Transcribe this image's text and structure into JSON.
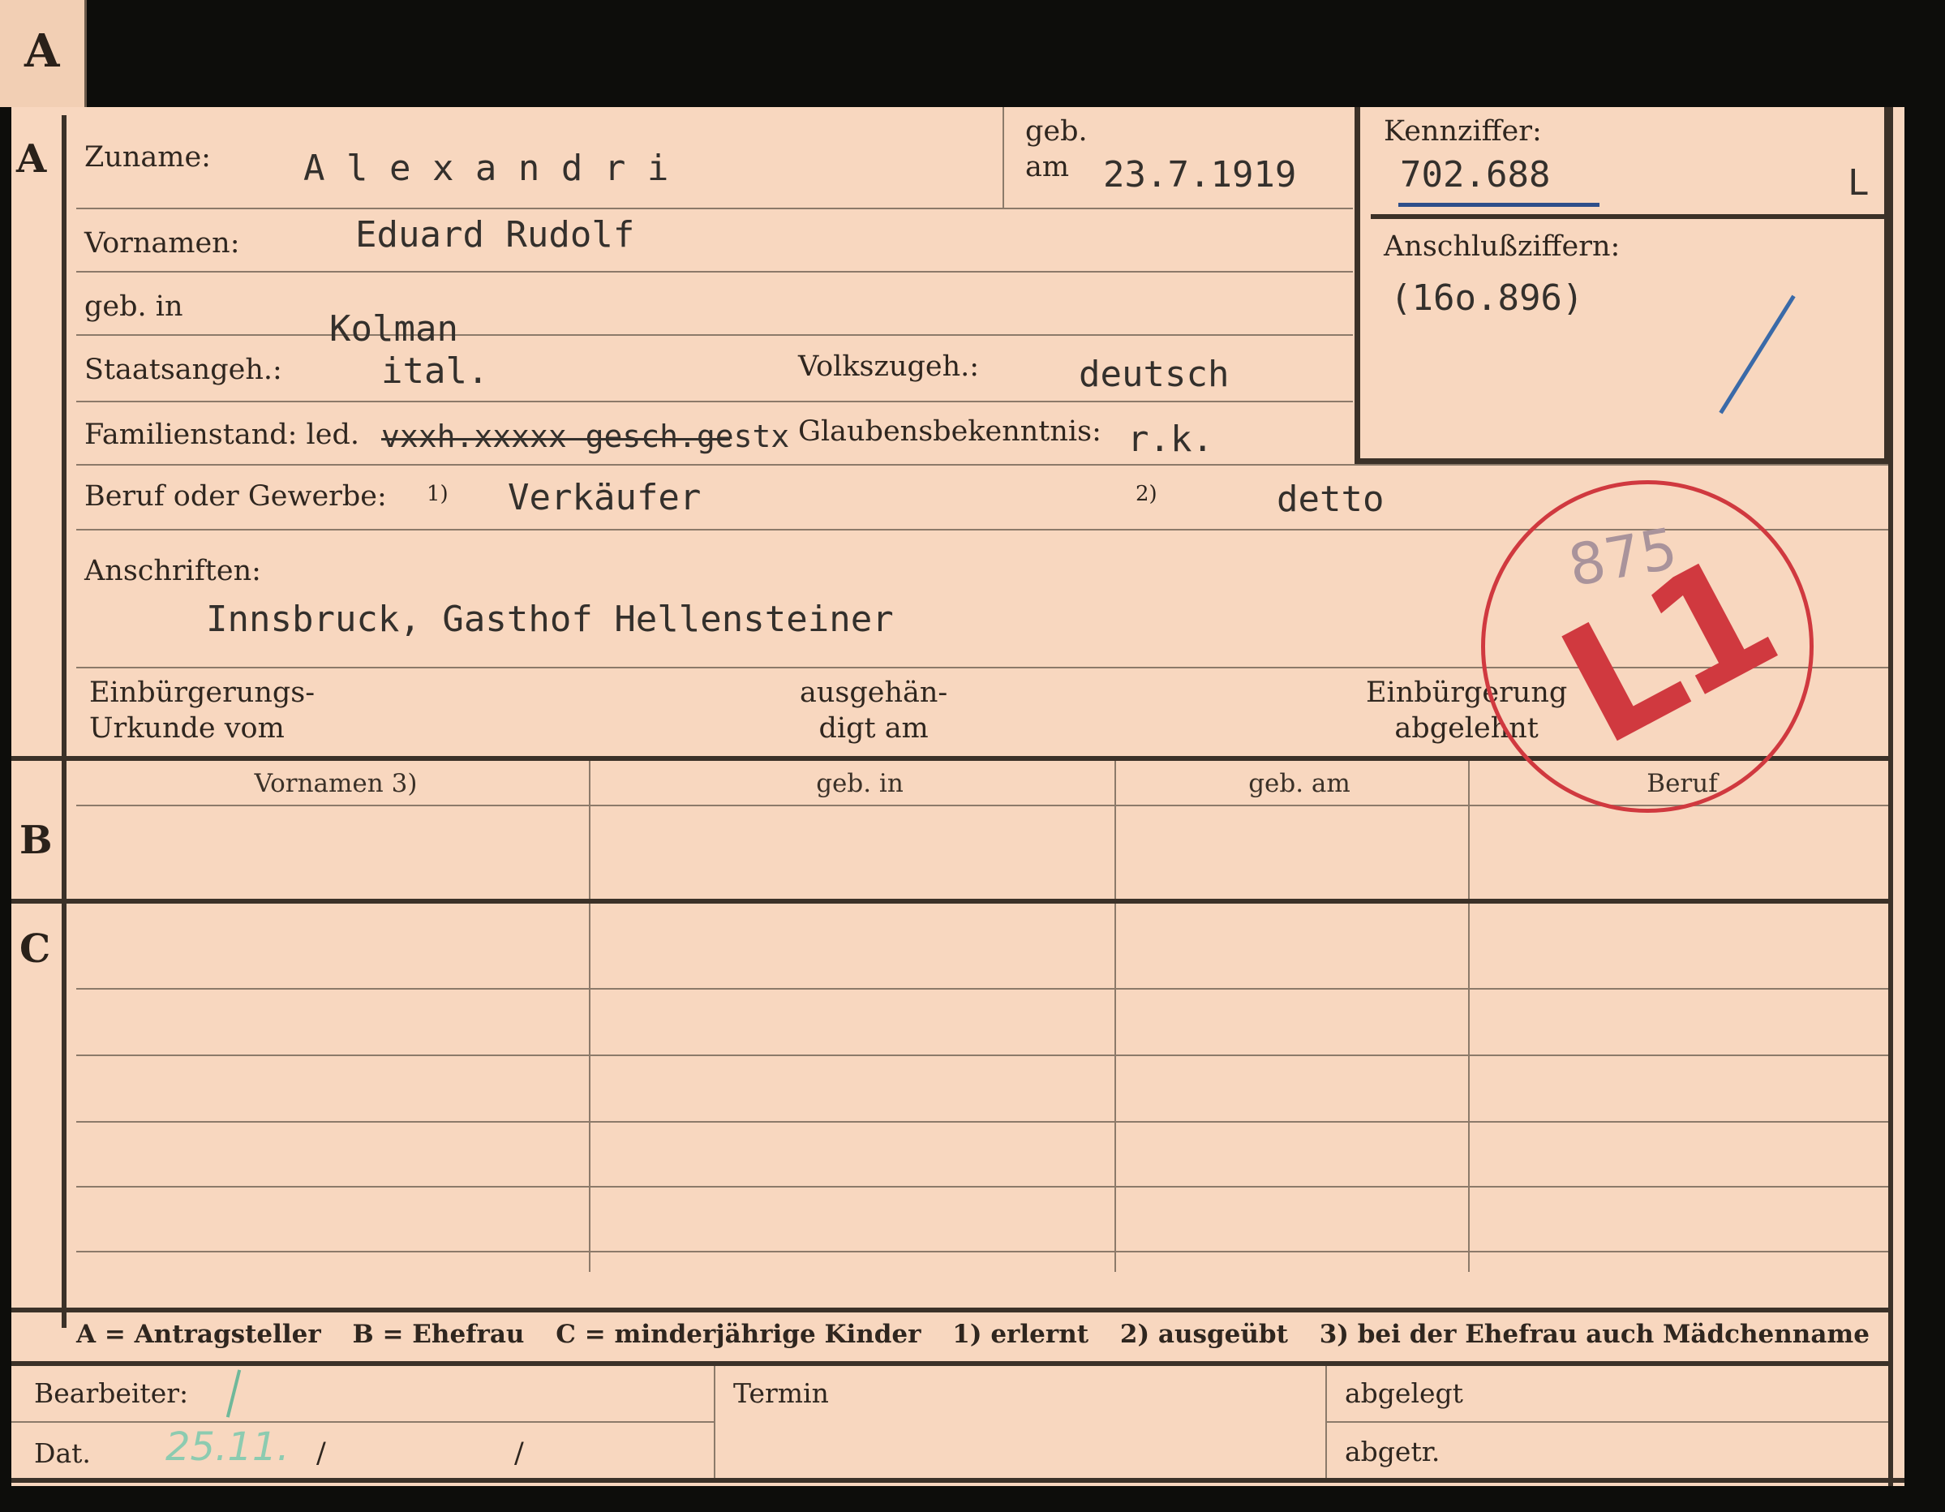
{
  "tab": {
    "letter": "A"
  },
  "section_letters": {
    "a": "A",
    "b": "B",
    "c": "C"
  },
  "fields": {
    "zuname_label": "Zuname:",
    "zuname_value": "A l e x a n d r i",
    "geb_label": "geb.",
    "am_label": "am",
    "birth_date": "23.7.1919",
    "kennziffer_label": "Kennziffer:",
    "kennziffer_value": "702.688",
    "kennziffer_suffix": "L",
    "vornamen_label": "Vornamen:",
    "vornamen_value": "Eduard Rudolf",
    "anschluss_label": "Anschlußziffern:",
    "anschluss_value": "(16o.896)",
    "geb_in_label": "geb. in",
    "geb_in_value": "Kolman",
    "staatsangeh_label": "Staatsangeh.:",
    "staatsangeh_value": "ital.",
    "volkszugeh_label": "Volkszugeh.:",
    "volkszugeh_value": "deutsch",
    "familienstand_label": "Familienstand: led.",
    "familienstand_struck": "vxxh.xxxxx gesch.gestx",
    "glauben_label": "Glaubensbekenntnis:",
    "glauben_value": "r.k.",
    "beruf_label": "Beruf oder Gewerbe:",
    "beruf_note1": "1)",
    "beruf_value1": "Verkäufer",
    "beruf_note2": "2)",
    "beruf_value2": "detto",
    "anschriften_label": "Anschriften:",
    "anschriften_value": "Innsbruck, Gasthof Hellensteiner",
    "einbuergerung_label": "Einbürgerungs-\nUrkunde vom",
    "ausgehaendigt_label": "ausgehän-\ndigt am",
    "abgelehnt_label": "Einbürgerung\nabgelehnt"
  },
  "table_headers": [
    "Vornamen 3)",
    "geb. in",
    "geb. am",
    "Beruf"
  ],
  "legend": [
    "A = Antragsteller",
    "B = Ehefrau",
    "C = minderjährige Kinder",
    "1) erlernt",
    "2) ausgeübt",
    "3) bei der Ehefrau auch Mädchenname"
  ],
  "footer": {
    "bearbeiter_label": "Bearbeiter:",
    "dat_label": "Dat.",
    "dat_value": "25.11.",
    "slash1": "/",
    "slash2": "/",
    "termin_label": "Termin",
    "abgelegt_label": "abgelegt",
    "abgetr_label": "abgetr."
  },
  "stamp": {
    "text": "L1",
    "pencil_number": "875",
    "color": "#d0393f"
  },
  "colors": {
    "card": "#f8d7bf",
    "ink": "#2f261f",
    "stamp": "#d0393f",
    "underline": "#2e4f8a"
  }
}
